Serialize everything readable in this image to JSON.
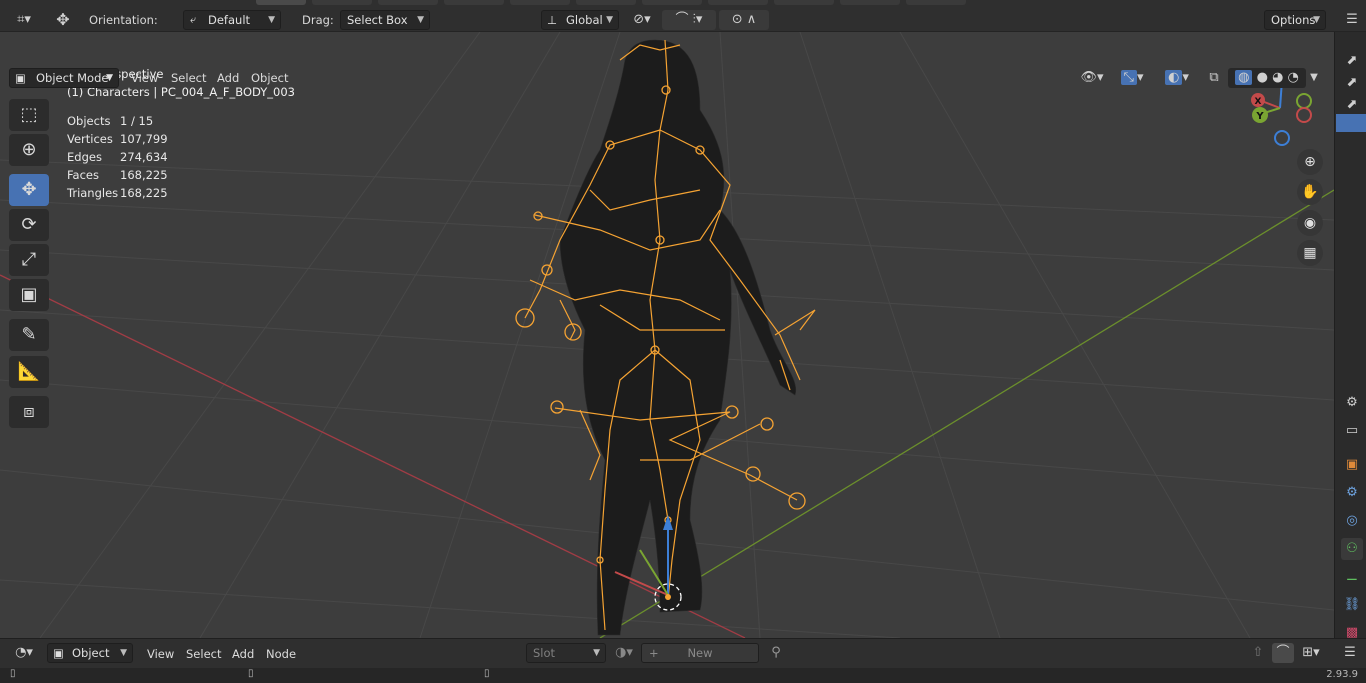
{
  "header": {
    "orientation_label": "Orientation:",
    "orientation_value": "Default",
    "drag_label": "Drag:",
    "drag_value": "Select Box",
    "transform_space": "Global",
    "options_label": "Options"
  },
  "viewport_header": {
    "mode": "Object Mode",
    "menu": [
      "View",
      "Select",
      "Add",
      "Object"
    ]
  },
  "overlay": {
    "perspective": "User Perspective",
    "collection_object": "(1) Characters | PC_004_A_F_BODY_003",
    "stats": [
      {
        "label": "Objects",
        "value": "1 / 15"
      },
      {
        "label": "Vertices",
        "value": "107,799"
      },
      {
        "label": "Edges",
        "value": "274,634"
      },
      {
        "label": "Faces",
        "value": "168,225"
      },
      {
        "label": "Triangles",
        "value": "168,225"
      }
    ]
  },
  "gizmo": {
    "z": "Z",
    "y": "Y",
    "x": "X"
  },
  "toolbar_icons": [
    "select-box-icon",
    "cursor-icon",
    "move-icon",
    "rotate-icon",
    "scale-icon",
    "transform-icon",
    "annotate-icon",
    "measure-icon",
    "add-cube-icon"
  ],
  "nav_icons": [
    "zoom-icon",
    "pan-hand-icon",
    "camera-icon",
    "grid-view-icon"
  ],
  "shader_editor": {
    "type_value": "Object",
    "menu": [
      "View",
      "Select",
      "Add",
      "Node"
    ],
    "slot_label": "Slot",
    "new_label": "New"
  },
  "status": {
    "version": "2.93.9"
  },
  "colors": {
    "accent": "#4772b3",
    "armature": "#f5a333",
    "x_axis": "#c34a4a",
    "y_axis": "#7aa532",
    "z_axis": "#3d7fd6"
  }
}
